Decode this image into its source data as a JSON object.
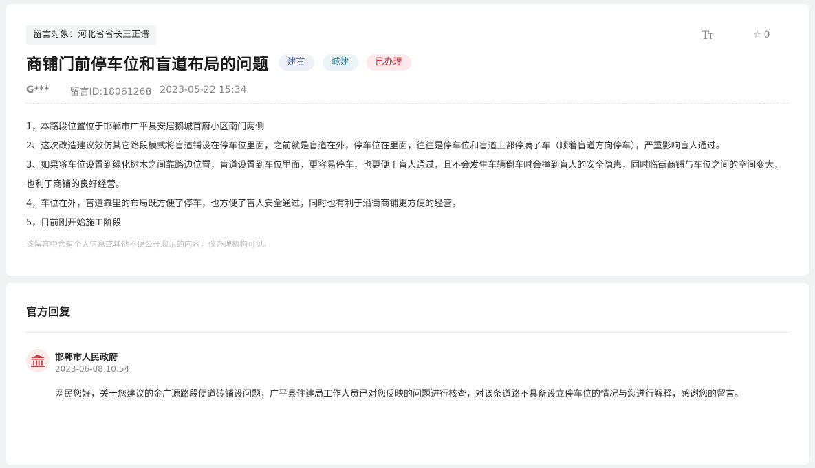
{
  "message": {
    "target": "留言对象：河北省省长王正谱",
    "font_toggle": {
      "big": "T",
      "small": "T"
    },
    "favorite_count": "0",
    "title": "商铺门前停车位和盲道布局的问题",
    "tags": {
      "suggest": "建言",
      "city": "城建",
      "status": "已办理"
    },
    "author": "G***",
    "message_id": "留言ID:18061268",
    "datetime": "2023-05-22 15:34",
    "paragraphs": [
      "1，本路段位置位于邯郸市广平县安居鹅城首府小区南门两侧",
      "2、这次改造建议效仿其它路段模式将盲道铺设在停车位里面，之前就是盲道在外，停车位在里面，往往是停车位和盲道上都停满了车（顺着盲道方向停车），严重影响盲人通过。",
      "3、如果将车位设置到绿化树木之间靠路边位置，盲道设置到车位里面，更容易停车，也更便于盲人通过，且不会发生车辆倒车时会撞到盲人的安全隐患，同时临街商铺与车位之间的空间变大，也利于商铺的良好经营。",
      "4，车位在外，盲道靠里的布局既方便了停车，也方便了盲人安全通过，同时也有利于沿街商铺更方便的经营。",
      "5，目前刚开始施工阶段"
    ],
    "privacy_notice": "该留言中含有个人信息或其他不便公开展示的内容，仅办理机构可见。"
  },
  "reply": {
    "heading": "官方回复",
    "organization": "邯郸市人民政府",
    "datetime": "2023-06-08 10:54",
    "text": "网民您好，关于您建议的金广源路段便道砖铺设问题，广平县住建局工作人员已对您反映的问题进行核查，对该条道路不具备设立停车位的情况与您进行解释，感谢您的留言。"
  },
  "colors": {
    "status_red": "#d0323f",
    "avatar_red": "#c9464e"
  }
}
